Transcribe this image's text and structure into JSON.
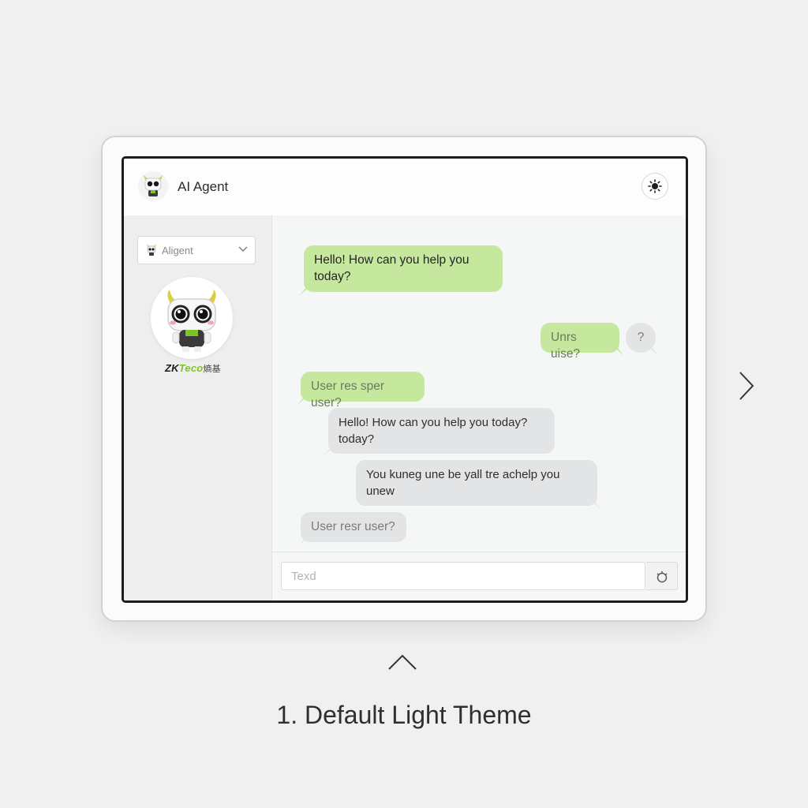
{
  "header": {
    "title": "AI Agent",
    "avatar_icon": "robot-mascot-icon",
    "theme_toggle_icon": "sun-icon"
  },
  "sidebar": {
    "agent_select": {
      "value": "Aligent",
      "icon": "chevron-down-icon"
    },
    "brand": {
      "prefix": "ZK",
      "mid": "Teco",
      "suffix": "熵基"
    }
  },
  "messages": [
    {
      "side": "left",
      "style": "green",
      "text": "Hello! How can you help you today?"
    },
    {
      "side": "right",
      "style": "green",
      "text": "Unrs uise?"
    },
    {
      "side": "right",
      "style": "gray",
      "text": "?"
    },
    {
      "side": "left",
      "style": "green",
      "text": "User res sper user?"
    },
    {
      "side": "left",
      "style": "gray",
      "text": "Hello! How can you help you today? today?"
    },
    {
      "side": "left",
      "style": "gray",
      "text": "You kuneg une be yall tre achelp you unew"
    },
    {
      "side": "left",
      "style": "gray",
      "text": "User resr user?"
    }
  ],
  "composer": {
    "placeholder": "Texd",
    "send_icon": "gear-icon"
  },
  "navigation": {
    "next_icon": "chevron-right-icon",
    "up_icon": "chevron-up-icon"
  },
  "caption": "1. Default Light Theme",
  "colors": {
    "accent_green": "#c5e89e",
    "bubble_gray": "#e3e4e6",
    "page_background": "#f0f0f0"
  }
}
